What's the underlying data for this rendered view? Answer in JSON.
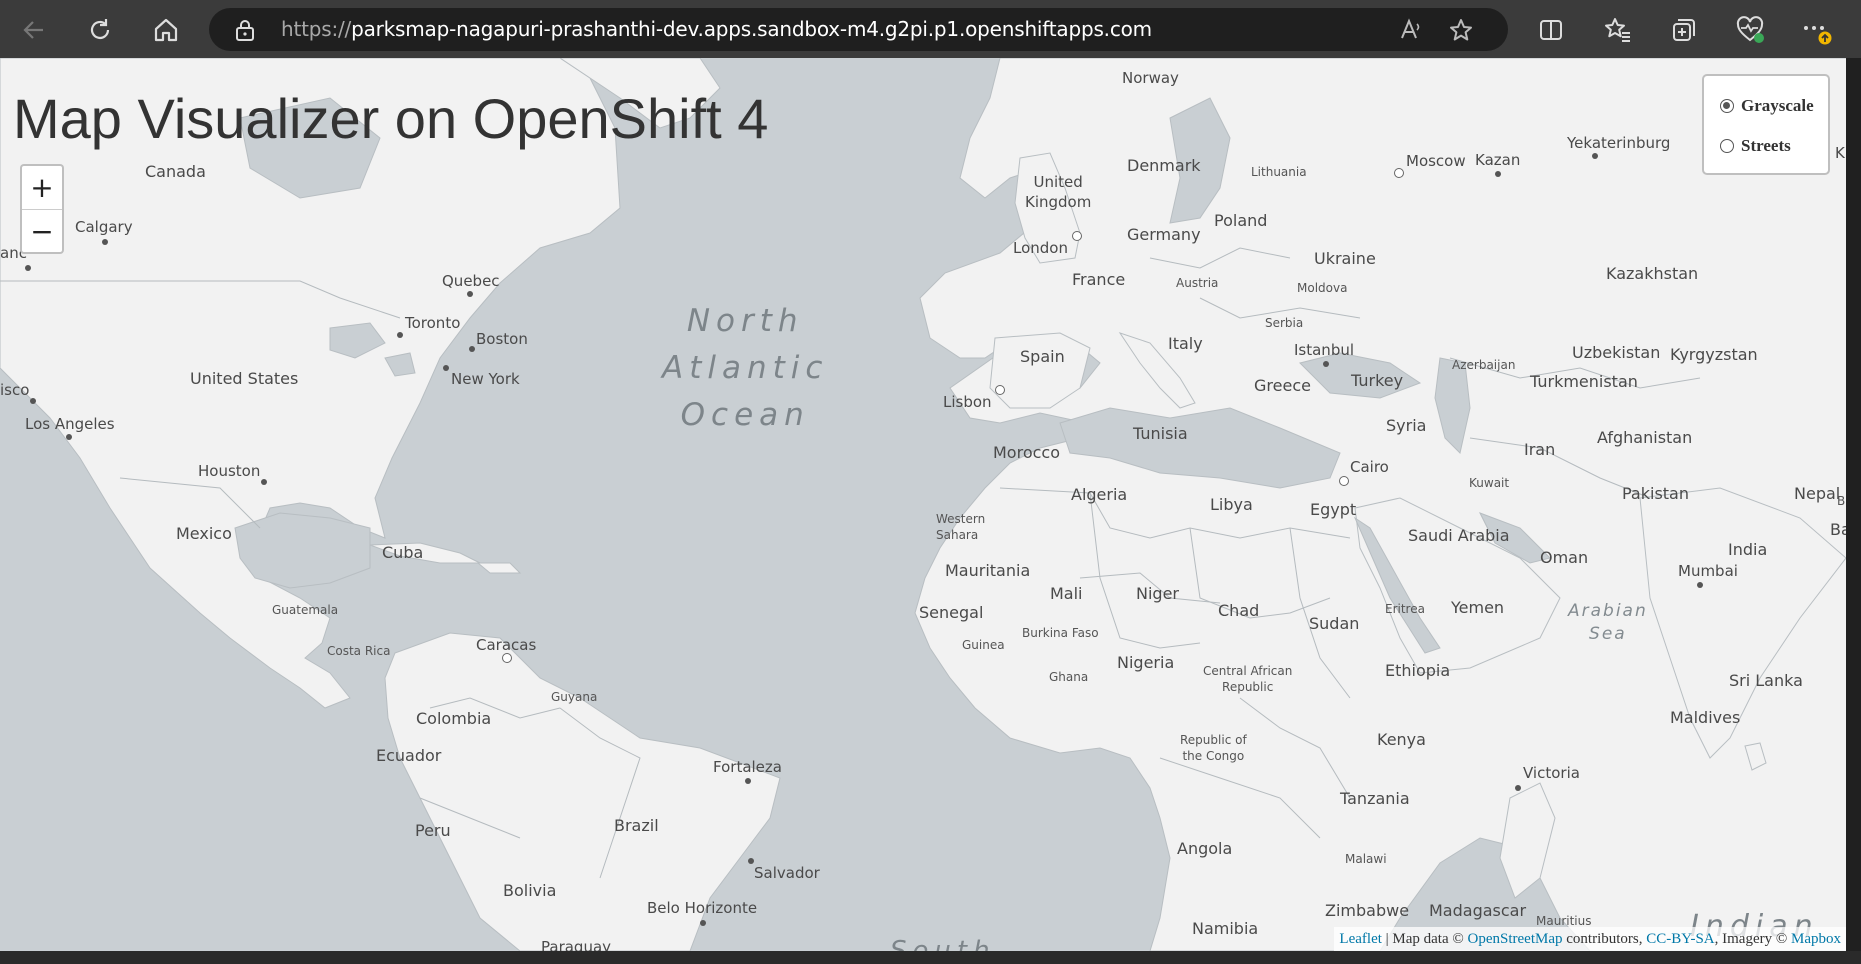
{
  "browser": {
    "url_scheme": "https://",
    "url_rest": "parksmap-nagapuri-prashanthi-dev.apps.sandbox-m4.g2pi.p1.openshiftapps.com",
    "icons": [
      "back-icon",
      "refresh-icon",
      "home-icon",
      "lock-icon",
      "read-aloud-icon",
      "favorite-star-icon",
      "split-screen-icon",
      "favorites-icon",
      "collections-icon",
      "browser-essentials-icon",
      "more-menu-icon"
    ]
  },
  "page": {
    "title": "Map Visualizer on OpenShift 4",
    "zoom_in": "+",
    "zoom_out": "−",
    "layers": {
      "grayscale": "Grayscale",
      "streets": "Streets",
      "selected": "Grayscale"
    },
    "attribution": {
      "leaflet": "Leaflet",
      "sep": " | Map data © ",
      "osm": "OpenStreetMap",
      "contrib": " contributors, ",
      "license": "CC-BY-SA",
      "imagery": ", Imagery © ",
      "mapbox": "Mapbox"
    }
  },
  "map": {
    "ocean_labels": {
      "north_atlantic": "North\nAtlantic\nOcean",
      "arabian_sea": "Arabian\nSea",
      "indian_ocean": "Indian"
    },
    "labels": {
      "norway": "Norway",
      "denmark": "Denmark",
      "united_kingdom": "United\nKingdom",
      "london": "London",
      "lithuania": "Lithuania",
      "moscow": "Moscow",
      "kazan": "Kazan",
      "yekaterinburg": "Yekaterinburg",
      "kra": "Kra",
      "canada": "Canada",
      "calgary": "Calgary",
      "quebec": "Quebec",
      "toronto": "Toronto",
      "boston": "Boston",
      "new_york": "New York",
      "united_states": "United States",
      "sisco": "isco",
      "los_angeles": "Los Angeles",
      "houston": "Houston",
      "mexico": "Mexico",
      "cuba": "Cuba",
      "guatemala": "Guatemala",
      "costa_rica": "Costa Rica",
      "caracas": "Caracas",
      "guyana": "Guyana",
      "colombia": "Colombia",
      "ecuador": "Ecuador",
      "peru": "Peru",
      "brazil": "Brazil",
      "fortaleza": "Fortaleza",
      "salvador": "Salvador",
      "bolivia": "Bolivia",
      "belo_horizonte": "Belo Horizonte",
      "paraguay": "Paraguay",
      "anc": "anc",
      "germany": "Germany",
      "poland": "Poland",
      "france": "France",
      "austria": "Austria",
      "ukraine": "Ukraine",
      "moldova": "Moldova",
      "kazakhstan": "Kazakhstan",
      "spain": "Spain",
      "lisbon": "Lisbon",
      "italy": "Italy",
      "serbia": "Serbia",
      "istanbul": "Istanbul",
      "greece": "Greece",
      "turkey": "Turkey",
      "azerbaijan": "Azerbaijan",
      "uzbekistan": "Uzbekistan",
      "kyrgyzstan": "Kyrgyzstan",
      "turkmenistan": "Turkmenistan",
      "tunisia": "Tunisia",
      "syria": "Syria",
      "iran": "Iran",
      "afghanistan": "Afghanistan",
      "morocco": "Morocco",
      "algeria": "Algeria",
      "libya": "Libya",
      "cairo": "Cairo",
      "egypt": "Egypt",
      "kuwait": "Kuwait",
      "pakistan": "Pakistan",
      "nepal": "Nepal",
      "bhu": "Bhu",
      "bangl": "Bangl",
      "western_sahara": "Western\nSahara",
      "saudi_arabia": "Saudi Arabia",
      "oman": "Oman",
      "india": "India",
      "mumbai": "Mumbai",
      "mauritania": "Mauritania",
      "mali": "Mali",
      "niger": "Niger",
      "chad": "Chad",
      "sudan": "Sudan",
      "eritrea": "Eritrea",
      "yemen": "Yemen",
      "senegal": "Senegal",
      "guinea": "Guinea",
      "burkina_faso": "Burkina Faso",
      "nigeria": "Nigeria",
      "ghana": "Ghana",
      "car": "Central African\nRepublic",
      "ethiopia": "Ethiopia",
      "sri_lanka": "Sri Lanka",
      "maldives": "Maldives",
      "congo": "Republic of\nthe Congo",
      "kenya": "Kenya",
      "victoria": "Victoria",
      "tanzania": "Tanzania",
      "angola": "Angola",
      "malawi": "Malawi",
      "zimbabwe": "Zimbabwe",
      "madagascar": "Madagascar",
      "namibia": "Namibia",
      "mauritius": "Mauritius",
      "south": "South"
    }
  }
}
